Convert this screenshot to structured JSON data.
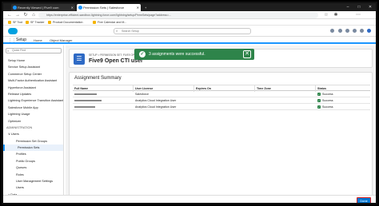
{
  "browser": {
    "tabs": [
      {
        "label": "Recently Viewed | Five9 com"
      },
      {
        "label": "Permission Sets | Salesforce"
      }
    ],
    "url": "https://enterprise-efficient-sandbox.lightning.force.com/lightning/setup/PermSets/page?address=...",
    "bookmarks": [
      "SF Tool",
      "SF Tracker",
      "Product Documentation",
      "Five Calendar and M..."
    ]
  },
  "sf_header": {
    "search_placeholder": "Search Setup"
  },
  "nav": {
    "app_name": "Setup",
    "tabs": [
      "Home",
      "Object Manager"
    ]
  },
  "sidebar": {
    "quick_find_placeholder": "Quick Find",
    "items": [
      {
        "label": "Setup Home",
        "level": "l1"
      },
      {
        "label": "Service Setup Assistant",
        "level": "l1"
      },
      {
        "label": "Commerce Setup Center",
        "level": "l1"
      },
      {
        "label": "Multi-Factor Authentication Assistant",
        "level": "l1"
      },
      {
        "label": "Hyperforce Assistant",
        "level": "l1"
      },
      {
        "label": "Release Updates",
        "level": "l1"
      },
      {
        "label": "Lightning Experience Transition Assistant",
        "level": "l1"
      },
      {
        "label": "Salesforce Mobile App",
        "level": "l1"
      },
      {
        "label": "Lightning Usage",
        "level": "l1"
      },
      {
        "label": "Optimizer",
        "level": "l1"
      },
      {
        "label": "ADMINISTRATION",
        "level": "section"
      },
      {
        "label": "∨ Users",
        "level": "l1"
      },
      {
        "label": "Permission Set Groups",
        "level": "l2"
      },
      {
        "label": "Permission Sets",
        "level": "l2",
        "selected": true
      },
      {
        "label": "Profiles",
        "level": "l2"
      },
      {
        "label": "Public Groups",
        "level": "l2"
      },
      {
        "label": "Queues",
        "level": "l2"
      },
      {
        "label": "Roles",
        "level": "l2"
      },
      {
        "label": "User Management Settings",
        "level": "l2"
      },
      {
        "label": "Users",
        "level": "l2"
      },
      {
        "label": "> Data",
        "level": "l1"
      }
    ]
  },
  "page": {
    "breadcrumb": "SETUP > PERMISSION SET: FIVE9 OPEN CTI USER",
    "title": "Five9 Open CTI user"
  },
  "toast": {
    "message": "3 assignments were successful.",
    "close_label": "✕"
  },
  "summary": {
    "title": "Assignment Summary",
    "columns": [
      "Full Name",
      "User License",
      "Expires On",
      "Time Zone",
      "Status"
    ],
    "rows": [
      {
        "license": "Salesforce",
        "status": "Success"
      },
      {
        "license": "Analytics Cloud Integration User",
        "status": "Success"
      },
      {
        "license": "Analytics Cloud Integration User",
        "status": "Success"
      }
    ]
  },
  "footer": {
    "done_label": "Done"
  }
}
